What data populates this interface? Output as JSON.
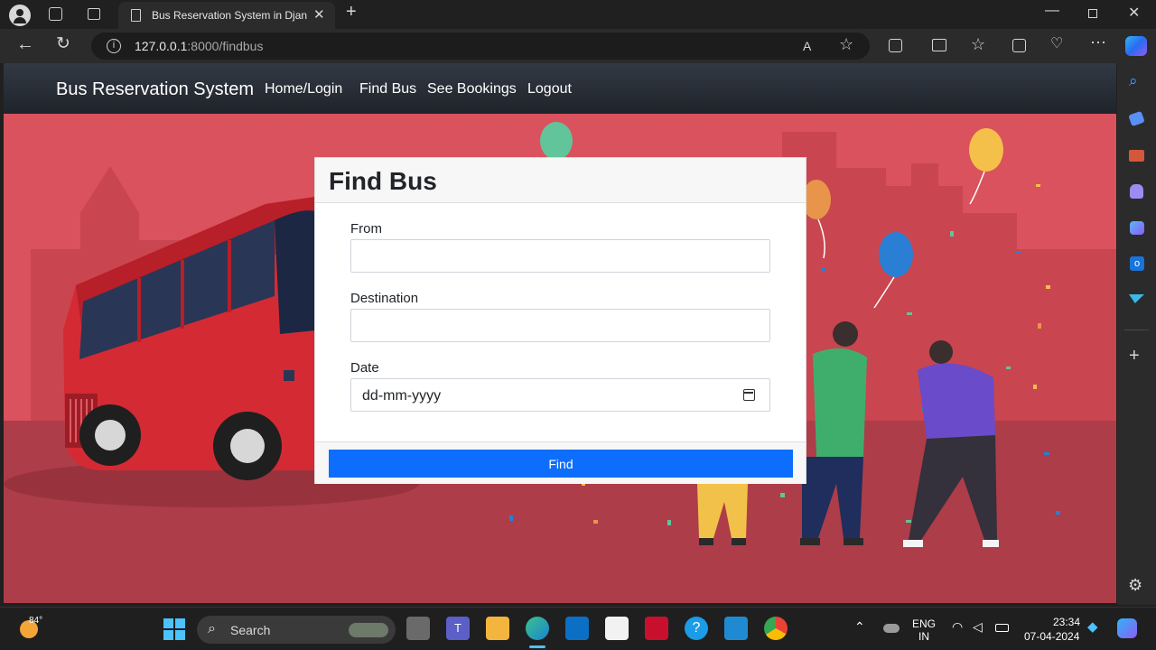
{
  "browser": {
    "tab_title": "Bus Reservation System in Djang",
    "url_host": "127.0.0.1",
    "url_rest": ":8000/findbus"
  },
  "navbar": {
    "brand": "Bus Reservation System",
    "links": [
      "Home/Login",
      "Find Bus",
      "See Bookings",
      "Logout"
    ]
  },
  "form": {
    "title": "Find Bus",
    "from_label": "From",
    "from_value": "",
    "destination_label": "Destination",
    "destination_value": "",
    "date_label": "Date",
    "date_placeholder": "dd-mm-yyyy",
    "submit_label": "Find"
  },
  "taskbar": {
    "weather_temp": "84°",
    "search_label": "Search",
    "lang_top": "ENG",
    "lang_bottom": "IN",
    "time": "23:34",
    "date": "07-04-2024"
  },
  "colors": {
    "primary": "#0d6efd",
    "navbar": "#252a31",
    "hero_bg": "#d9525d"
  }
}
